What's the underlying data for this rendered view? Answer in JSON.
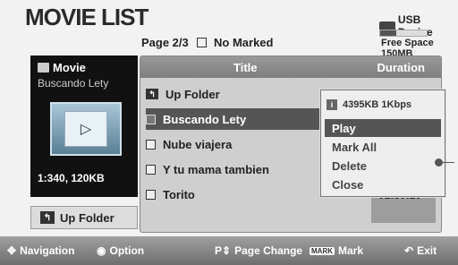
{
  "header": {
    "title": "MOVIE LIST",
    "page": "Page 2/3",
    "marked": "No Marked",
    "device": "USB Device",
    "free_space": "Free Space 150MB",
    "free_fraction": 0.35
  },
  "side_panel": {
    "type_label": "Movie",
    "current_name": "Buscando Lety",
    "meta": "1:340, 120KB",
    "up_folder_label": "Up Folder"
  },
  "list": {
    "col_title": "Title",
    "col_duration": "Duration",
    "up_folder": "Up Folder",
    "items": [
      {
        "name": "Buscando Lety",
        "selected": true
      },
      {
        "name": "Nube viajera",
        "selected": false
      },
      {
        "name": "Y tu mama tambien",
        "selected": false
      },
      {
        "name": "Torito",
        "selected": false
      }
    ],
    "partial_duration": "01:30:20"
  },
  "popup": {
    "info": "4395KB 1Kbps",
    "items": [
      "Play",
      "Mark All",
      "Delete",
      "Close"
    ],
    "active": "Play"
  },
  "footer": {
    "navigation": "Navigation",
    "option": "Option",
    "page_change": "Page Change",
    "mark_key": "MARK",
    "mark": "Mark",
    "exit": "Exit"
  }
}
